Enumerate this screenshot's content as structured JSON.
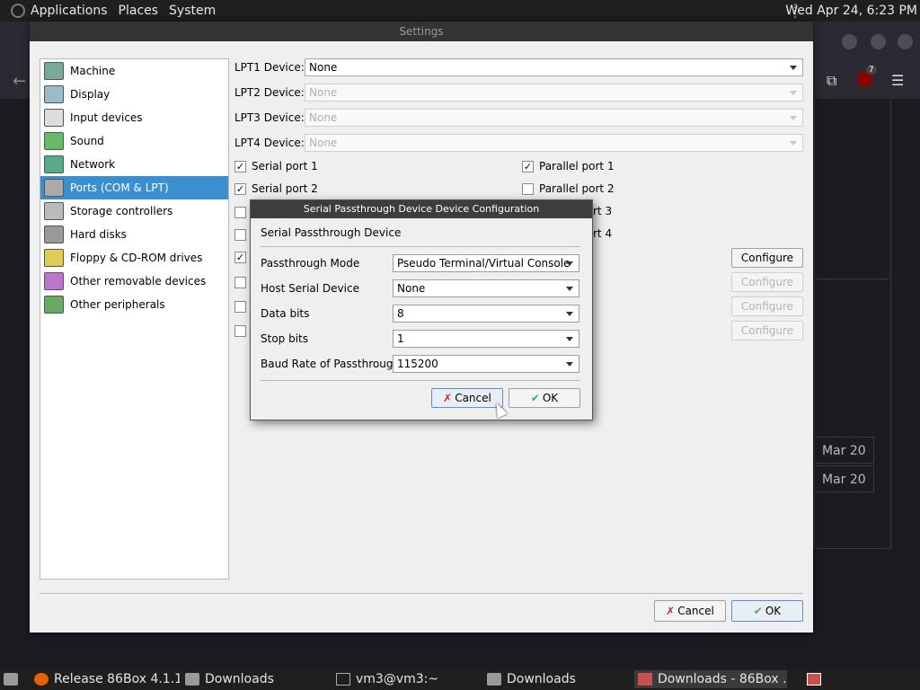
{
  "top_panel": {
    "menus": [
      "Applications",
      "Places",
      "System"
    ],
    "clock": "Wed Apr 24, 6:23 PM"
  },
  "browser": {
    "ublock_count": "7",
    "dates": [
      "Mar 20",
      "Mar 20"
    ]
  },
  "settings": {
    "title": "Settings",
    "sidebar": [
      {
        "label": "Machine",
        "icon": "machine-icon"
      },
      {
        "label": "Display",
        "icon": "display-icon"
      },
      {
        "label": "Input devices",
        "icon": "input-devices-icon"
      },
      {
        "label": "Sound",
        "icon": "sound-icon"
      },
      {
        "label": "Network",
        "icon": "network-icon"
      },
      {
        "label": "Ports (COM & LPT)",
        "icon": "ports-icon",
        "selected": true
      },
      {
        "label": "Storage controllers",
        "icon": "storage-icon"
      },
      {
        "label": "Hard disks",
        "icon": "hard-disk-icon"
      },
      {
        "label": "Floppy & CD-ROM drives",
        "icon": "floppy-cdrom-icon"
      },
      {
        "label": "Other removable devices",
        "icon": "removable-icon"
      },
      {
        "label": "Other peripherals",
        "icon": "peripherals-icon"
      }
    ],
    "lpt": [
      {
        "label": "LPT1 Device:",
        "value": "None",
        "enabled": true
      },
      {
        "label": "LPT2 Device:",
        "value": "None",
        "enabled": false
      },
      {
        "label": "LPT3 Device:",
        "value": "None",
        "enabled": false
      },
      {
        "label": "LPT4 Device:",
        "value": "None",
        "enabled": false
      }
    ],
    "serial_ports": [
      {
        "label": "Serial port 1",
        "checked": true
      },
      {
        "label": "Serial port 2",
        "checked": true
      }
    ],
    "parallel_ports": [
      {
        "label": "Parallel port 1",
        "checked": true
      },
      {
        "label": "Parallel port 2",
        "checked": false
      },
      {
        "label": "rt 3"
      },
      {
        "label": "rt 4"
      }
    ],
    "configure_label": "Configure",
    "cancel_label": "Cancel",
    "ok_label": "OK"
  },
  "dialog": {
    "title": "Serial Passthrough Device Device Configuration",
    "heading": "Serial Passthrough Device",
    "fields": [
      {
        "label": "Passthrough Mode",
        "value": "Pseudo Terminal/Virtual Console"
      },
      {
        "label": "Host Serial Device",
        "value": "None"
      },
      {
        "label": "Data bits",
        "value": "8"
      },
      {
        "label": "Stop bits",
        "value": "1"
      },
      {
        "label": "Baud Rate of Passthrough",
        "value": "115200"
      }
    ],
    "cancel_label": "Cancel",
    "ok_label": "OK"
  },
  "taskbar": {
    "tasks": [
      {
        "label": "Release 86Box 4.1.1 ...",
        "icon": "firefox-icon"
      },
      {
        "label": "Downloads",
        "icon": "folder-icon"
      },
      {
        "label": "vm3@vm3:~",
        "icon": "terminal-icon"
      },
      {
        "label": "Downloads",
        "icon": "folder-icon"
      },
      {
        "label": "Downloads - 86Box ...",
        "icon": "86box-icon"
      }
    ]
  }
}
